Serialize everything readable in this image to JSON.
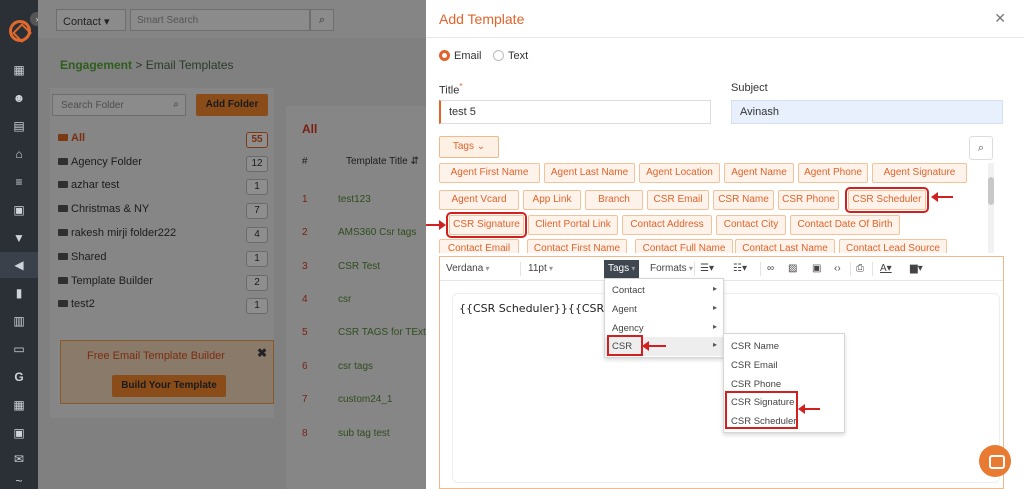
{
  "app": {
    "brand_color": "#e2632b"
  },
  "rail_icons": [
    "dashboard-icon",
    "people-icon",
    "document-icon",
    "bank-icon",
    "list-icon",
    "contact-card-icon",
    "funnel-icon",
    "megaphone-icon",
    "page-icon",
    "chart-icon",
    "folder-icon",
    "g-icon",
    "calculator-icon",
    "calendar-icon",
    "mail-icon",
    "signature-icon"
  ],
  "topbar": {
    "entity_select": "Contact",
    "search_placeholder": "Smart Search"
  },
  "breadcrumb": {
    "section": "Engagement",
    "separator": ">",
    "page": "Email Templates"
  },
  "folders_panel": {
    "search_placeholder": "Search Folder",
    "add_label": "Add Folder",
    "folders": [
      {
        "name": "All",
        "count": "55"
      },
      {
        "name": "Agency Folder",
        "count": "12"
      },
      {
        "name": "azhar test",
        "count": "1"
      },
      {
        "name": "Christmas & NY",
        "count": "7"
      },
      {
        "name": "rakesh mirji folder222",
        "count": "4"
      },
      {
        "name": "Shared",
        "count": "1"
      },
      {
        "name": "Template Builder",
        "count": "2"
      },
      {
        "name": "test2",
        "count": "1"
      }
    ],
    "promo_title": "Free Email Template Builder",
    "promo_button": "Build Your Template"
  },
  "templates_panel": {
    "filter_label": "All",
    "columns": [
      "#",
      "Template Title"
    ],
    "rows": [
      {
        "n": "1",
        "title": "test123"
      },
      {
        "n": "2",
        "title": "AMS360 Csr tags"
      },
      {
        "n": "3",
        "title": "CSR Test"
      },
      {
        "n": "4",
        "title": "csr"
      },
      {
        "n": "5",
        "title": "CSR TAGS for TExt"
      },
      {
        "n": "6",
        "title": "csr tags"
      },
      {
        "n": "7",
        "title": "custom24_1"
      },
      {
        "n": "8",
        "title": "sub tag test"
      }
    ]
  },
  "modal": {
    "title": "Add Template",
    "radio_email": "Email",
    "radio_text": "Text",
    "title_label": "Title",
    "title_required": "*",
    "title_value": "test 5",
    "subject_label": "Subject",
    "subject_value": "Avinash",
    "tags_button": "Tags",
    "tags": [
      "Agent First Name",
      "Agent Last Name",
      "Agent Location",
      "Agent Name",
      "Agent Phone",
      "Agent Signature",
      "Agent Vcard",
      "App Link",
      "Branch",
      "CSR Email",
      "CSR Name",
      "CSR Phone",
      "CSR Scheduler",
      "CSR Signature",
      "Client Portal Link",
      "Contact Address",
      "Contact City",
      "Contact Date Of Birth",
      "Contact Email",
      "Contact First Name",
      "Contact Full Name",
      "Contact Last Name",
      "Contact Lead Source"
    ],
    "toolbar": {
      "font": "Verdana",
      "size": "11pt",
      "tags": "Tags",
      "formats": "Formats"
    },
    "editor_text": "{{CSR Scheduler}}{{CSR Signature}}",
    "tags_menu": [
      {
        "label": "Contact"
      },
      {
        "label": "Agent"
      },
      {
        "label": "Agency"
      },
      {
        "label": "CSR"
      }
    ],
    "csr_submenu": [
      "CSR Name",
      "CSR Email",
      "CSR Phone",
      "CSR Signature",
      "CSR Scheduler"
    ]
  }
}
